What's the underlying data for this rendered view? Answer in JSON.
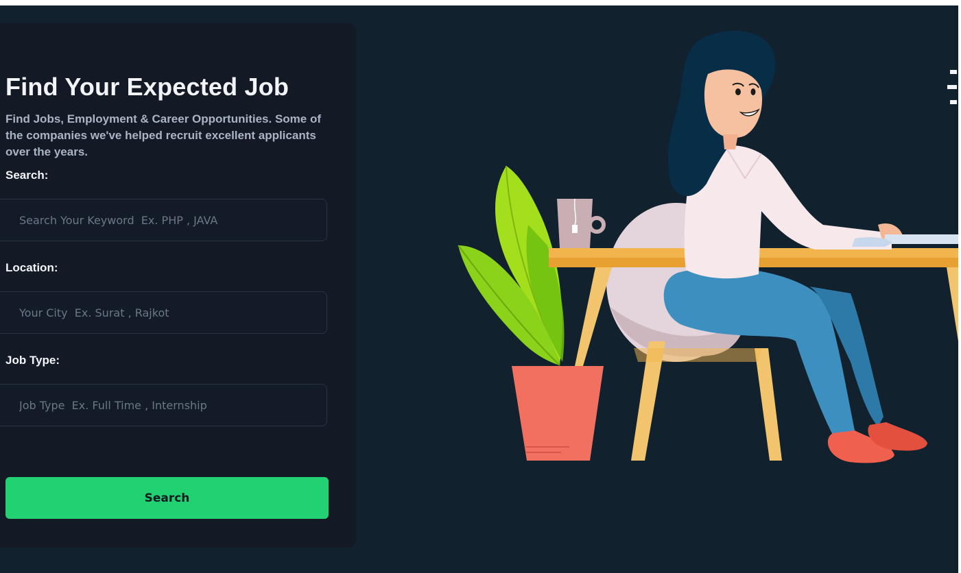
{
  "hero": {
    "title": "Find Your Expected Job",
    "subtitle": "Find Jobs, Employment & Career Opportunities. Some of the companies we've helped recruit excellent applicants over the years."
  },
  "form": {
    "search": {
      "label": "Search:",
      "placeholder": "Search Your Keyword  Ex. PHP , JAVA",
      "value": ""
    },
    "location": {
      "label": "Location:",
      "placeholder": "Your City  Ex. Surat , Rajkot",
      "value": ""
    },
    "job_type": {
      "label": "Job Type:",
      "placeholder": "Job Type  Ex. Full Time , Internship",
      "value": ""
    },
    "submit_label": "Search"
  },
  "colors": {
    "background": "#12212e",
    "panel": "#131a26",
    "accent": "#22d172",
    "title_text": "#f2f4f8",
    "muted_text": "#aab4c4"
  },
  "illustration": {
    "name": "woman-working-at-desk-illustration"
  }
}
